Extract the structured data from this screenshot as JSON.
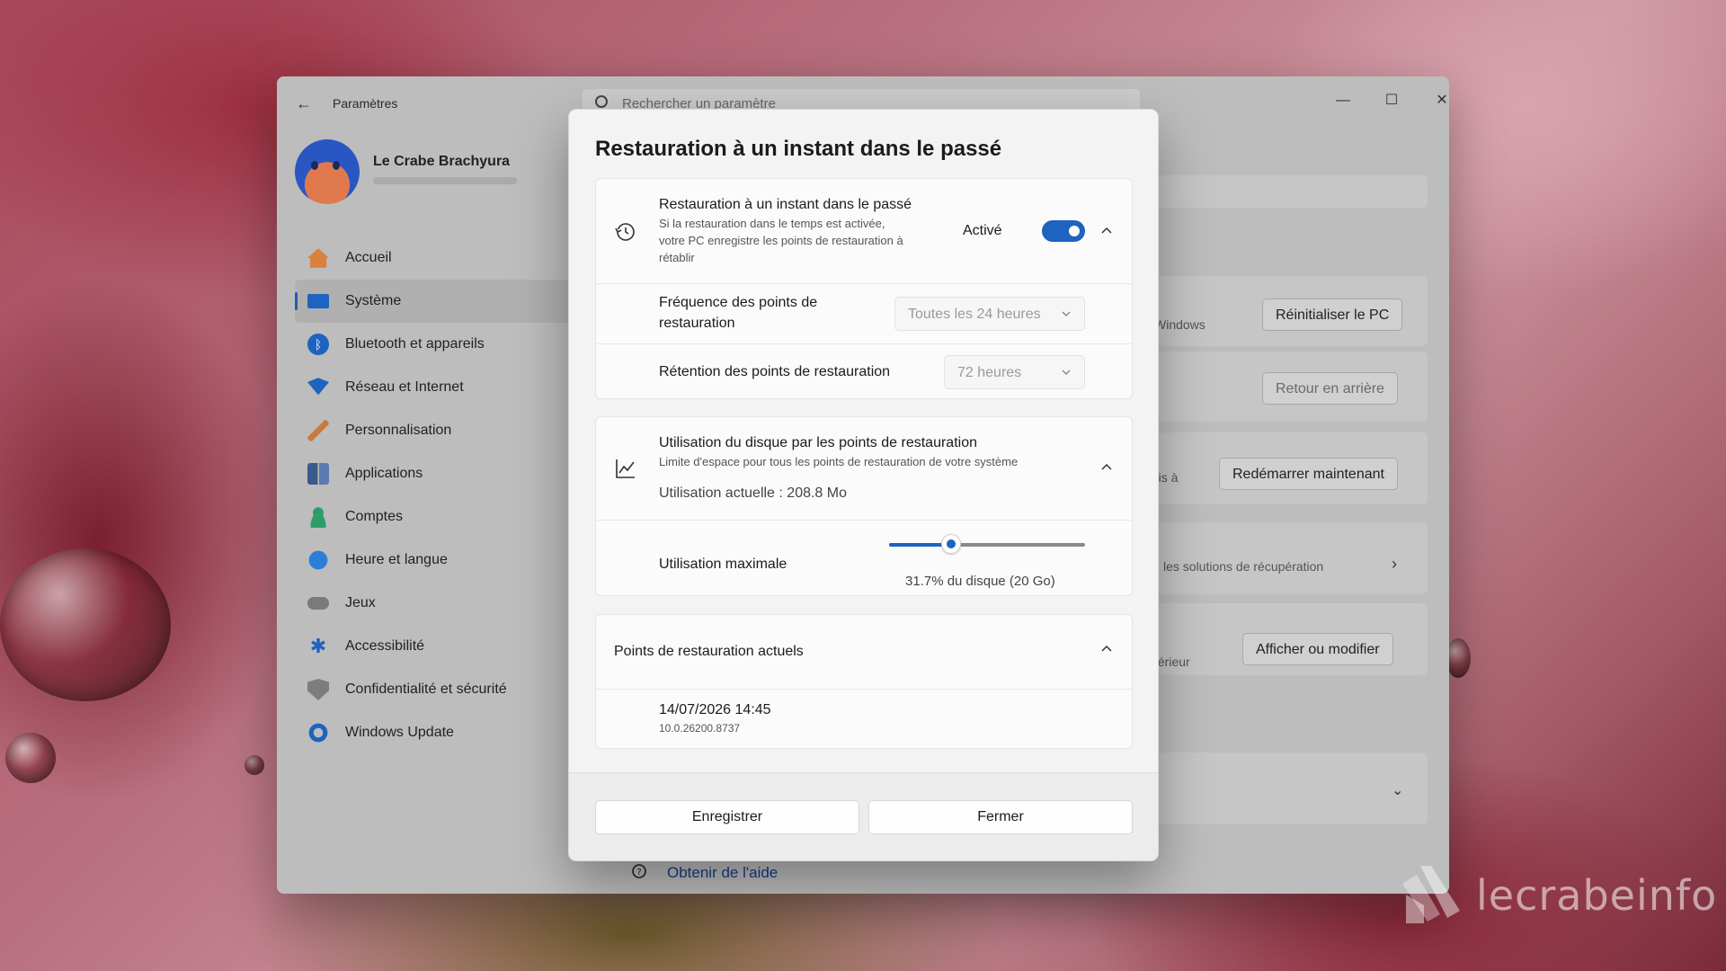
{
  "window": {
    "app_title": "Paramètres",
    "search_placeholder": "Rechercher un paramètre",
    "controls": [
      "minimize",
      "maximize",
      "close"
    ]
  },
  "profile": {
    "name": "Le Crabe Brachyura"
  },
  "sidebar": {
    "items": [
      {
        "label": "Accueil",
        "icon": "home-icon",
        "color": "#d9823f"
      },
      {
        "label": "Système",
        "icon": "system-icon",
        "color": "#1f63c0",
        "active": true
      },
      {
        "label": "Bluetooth et appareils",
        "icon": "bluetooth-icon",
        "color": "#1f63c0"
      },
      {
        "label": "Réseau et Internet",
        "icon": "wifi-icon",
        "color": "#1f63c0"
      },
      {
        "label": "Personnalisation",
        "icon": "brush-icon",
        "color": "#c97a3c"
      },
      {
        "label": "Applications",
        "icon": "apps-icon",
        "color": "#3a5a8c"
      },
      {
        "label": "Comptes",
        "icon": "account-icon",
        "color": "#2f9d6a"
      },
      {
        "label": "Heure et langue",
        "icon": "clock-globe-icon",
        "color": "#1f63c0"
      },
      {
        "label": "Jeux",
        "icon": "gamepad-icon",
        "color": "#777777"
      },
      {
        "label": "Accessibilité",
        "icon": "accessibility-icon",
        "color": "#1f63c0"
      },
      {
        "label": "Confidentialité et sécurité",
        "icon": "shield-icon",
        "color": "#777777"
      },
      {
        "label": "Windows Update",
        "icon": "update-icon",
        "color": "#1f63c0"
      }
    ]
  },
  "background_page": {
    "reset_hint": "Windows",
    "reset_button": "Réinitialiser le PC",
    "go_back_button": "Retour en arrière",
    "restart_hint": "ris à",
    "restart_button": "Redémarrer maintenant",
    "recovery_link": "les solutions de récupération",
    "external_hint": "térieur",
    "view_edit_button": "Afficher ou modifier",
    "help_link": "Obtenir de l'aide"
  },
  "dialog": {
    "title": "Restauration à un instant dans le passé",
    "restore_card": {
      "title": "Restauration à un instant dans le passé",
      "description_line1": "Si la restauration dans le temps est activée,",
      "description_line2": "votre PC enregistre les points de restauration à",
      "description_line3": "rétablir",
      "status": "Activé",
      "toggle_on": true,
      "frequency_label_line1": "Fréquence des points de",
      "frequency_label_line2": "restauration",
      "frequency_value": "Toutes les 24 heures",
      "retention_label": "Rétention des points de restauration",
      "retention_value": "72 heures"
    },
    "disk_card": {
      "title": "Utilisation du disque par les points de restauration",
      "description": "Limite d'espace pour tous les points de restauration de votre système",
      "current_usage": "Utilisation actuelle : 208.8 Mo",
      "max_label": "Utilisation maximale",
      "slider_fraction": 0.317,
      "slider_text": "31.7% du disque (20 Go)"
    },
    "points_card": {
      "title": "Points de restauration actuels",
      "entries": [
        {
          "date": "14/07/2026 14:45",
          "build": "10.0.26200.8737"
        }
      ]
    },
    "save_button": "Enregistrer",
    "close_button": "Fermer"
  },
  "watermark": "lecrabeinfo",
  "colors": {
    "accent": "#1f63c0",
    "link": "#163d88"
  }
}
